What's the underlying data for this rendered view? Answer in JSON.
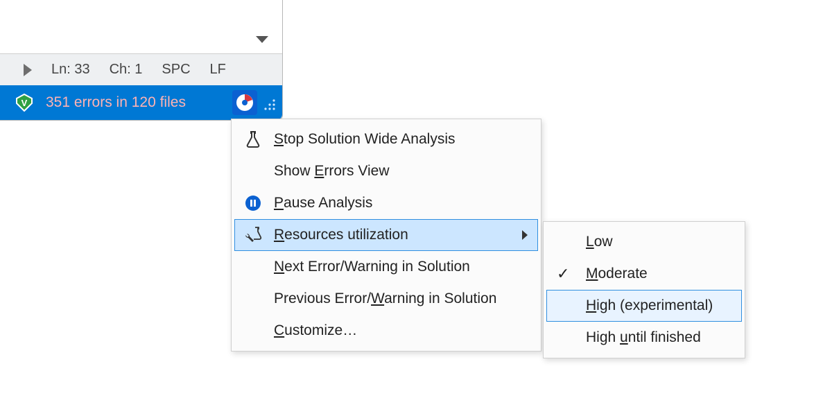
{
  "info_strip": {
    "line_label": "Ln: 33",
    "char_label": "Ch: 1",
    "indent_label": "SPC",
    "eol_label": "LF"
  },
  "status_bar": {
    "error_text": "351 errors in 120 files"
  },
  "menu": {
    "stop": {
      "pre": "",
      "m": "S",
      "post": "top Solution Wide Analysis"
    },
    "show_errors": {
      "pre": "Show ",
      "m": "E",
      "post": "rrors View"
    },
    "pause": {
      "pre": "",
      "m": "P",
      "post": "ause Analysis"
    },
    "resources": {
      "pre": "",
      "m": "R",
      "post": "esources utilization"
    },
    "next": {
      "pre": "",
      "m": "N",
      "post": "ext Error/Warning in Solution"
    },
    "previous": {
      "pre": "Previous Error/",
      "m": "W",
      "post": "arning in Solution"
    },
    "customize": {
      "pre": "",
      "m": "C",
      "post": "ustomize…"
    }
  },
  "submenu": {
    "low": {
      "pre": "",
      "m": "L",
      "post": "ow"
    },
    "moderate": {
      "pre": "",
      "m": "M",
      "post": "oderate",
      "checked": true
    },
    "high": {
      "pre": "",
      "m": "H",
      "post": "igh (experimental)"
    },
    "high_until": {
      "pre": "High ",
      "m": "u",
      "post": "ntil finished"
    }
  }
}
